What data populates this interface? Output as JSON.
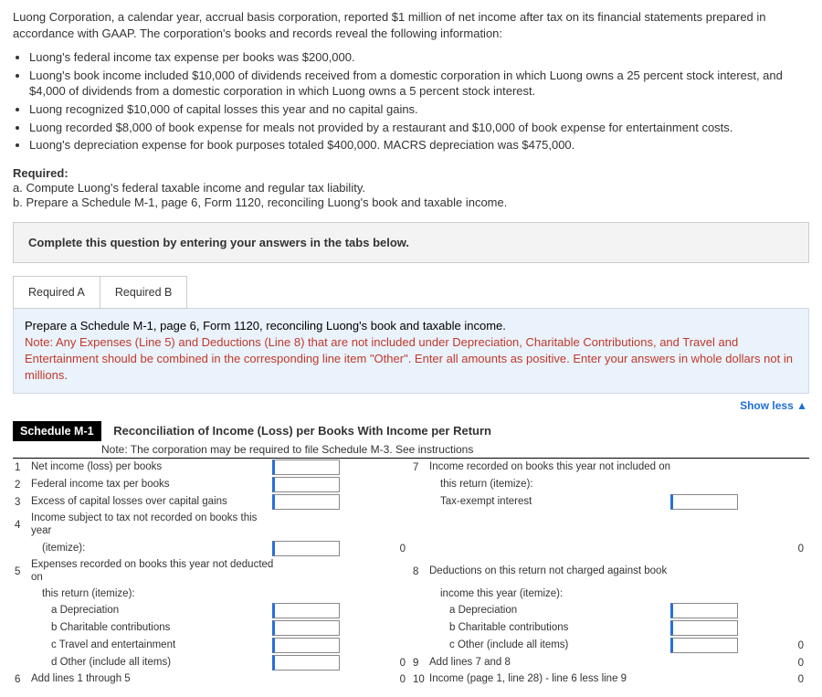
{
  "intro": "Luong Corporation, a calendar year, accrual basis corporation, reported $1 million of net income after tax on its financial statements prepared in accordance with GAAP. The corporation's books and records reveal the following information:",
  "facts": [
    "Luong's federal income tax expense per books was $200,000.",
    "Luong's book income included $10,000 of dividends received from a domestic corporation in which Luong owns a 25 percent stock interest, and $4,000 of dividends from a domestic corporation in which Luong owns a 5 percent stock interest.",
    "Luong recognized $10,000 of capital losses this year and no capital gains.",
    "Luong recorded $8,000 of book expense for meals not provided by a restaurant and $10,000 of book expense for entertainment costs.",
    "Luong's depreciation expense for book purposes totaled $400,000. MACRS depreciation was $475,000."
  ],
  "required": {
    "heading": "Required:",
    "a": "a. Compute Luong's federal taxable income and regular tax liability.",
    "b": "b. Prepare a Schedule M-1, page 6, Form 1120, reconciling Luong's book and taxable income."
  },
  "prompt_box": "Complete this question by entering your answers in the tabs below.",
  "tabs": {
    "a": "Required A",
    "b": "Required B"
  },
  "note": {
    "line1": "Prepare a Schedule M-1, page 6, Form 1120, reconciling Luong's book and taxable income.",
    "line2a": "Note: Any Expenses (Line 5) and Deductions (Line 8) that are not included under Depreciation, Charitable Contributions, and Travel and Entertainment should be combined in the corresponding line item \"Other\".",
    "line2b": " Enter all amounts as positive. Enter your answers in whole dollars not in millions."
  },
  "showless": "Show less ▲",
  "schedule": {
    "tag": "Schedule M-1",
    "title": "Reconciliation of Income (Loss) per Books With Income per Return",
    "note": "Note: The corporation may be required to file Schedule M-3. See instructions",
    "left": {
      "r1": "Net income (loss) per books",
      "r2": "Federal income tax per books",
      "r3": "Excess of capital losses over capital gains",
      "r4": "Income subject to tax not recorded on books this year",
      "r4b": "(itemize):",
      "r4_val": "0",
      "r5": "Expenses recorded on books this year not deducted on",
      "r5b": "this return (itemize):",
      "r5a": "a  Depreciation",
      "r5b_": "b  Charitable contributions",
      "r5c": "c  Travel and entertainment",
      "r5d": "d  Other (include all items)",
      "r5_val": "0",
      "r6": "Add lines 1 through 5",
      "r6_val": "0"
    },
    "right": {
      "r7": "Income recorded on books this year not included on",
      "r7b": "this return (itemize):",
      "r7c": "Tax-exempt interest",
      "r7_val": "0",
      "r8": "Deductions on this return not charged against book",
      "r8b": "income this year (itemize):",
      "r8a": "a  Depreciation",
      "r8b_": "b  Charitable contributions",
      "r8c": "c  Other (include all items)",
      "r8_val": "0",
      "r9": "Add lines 7 and 8",
      "r9_val": "0",
      "r10": "Income (page 1, line 28) - line 6 less line 9",
      "r10_val": "0"
    }
  }
}
